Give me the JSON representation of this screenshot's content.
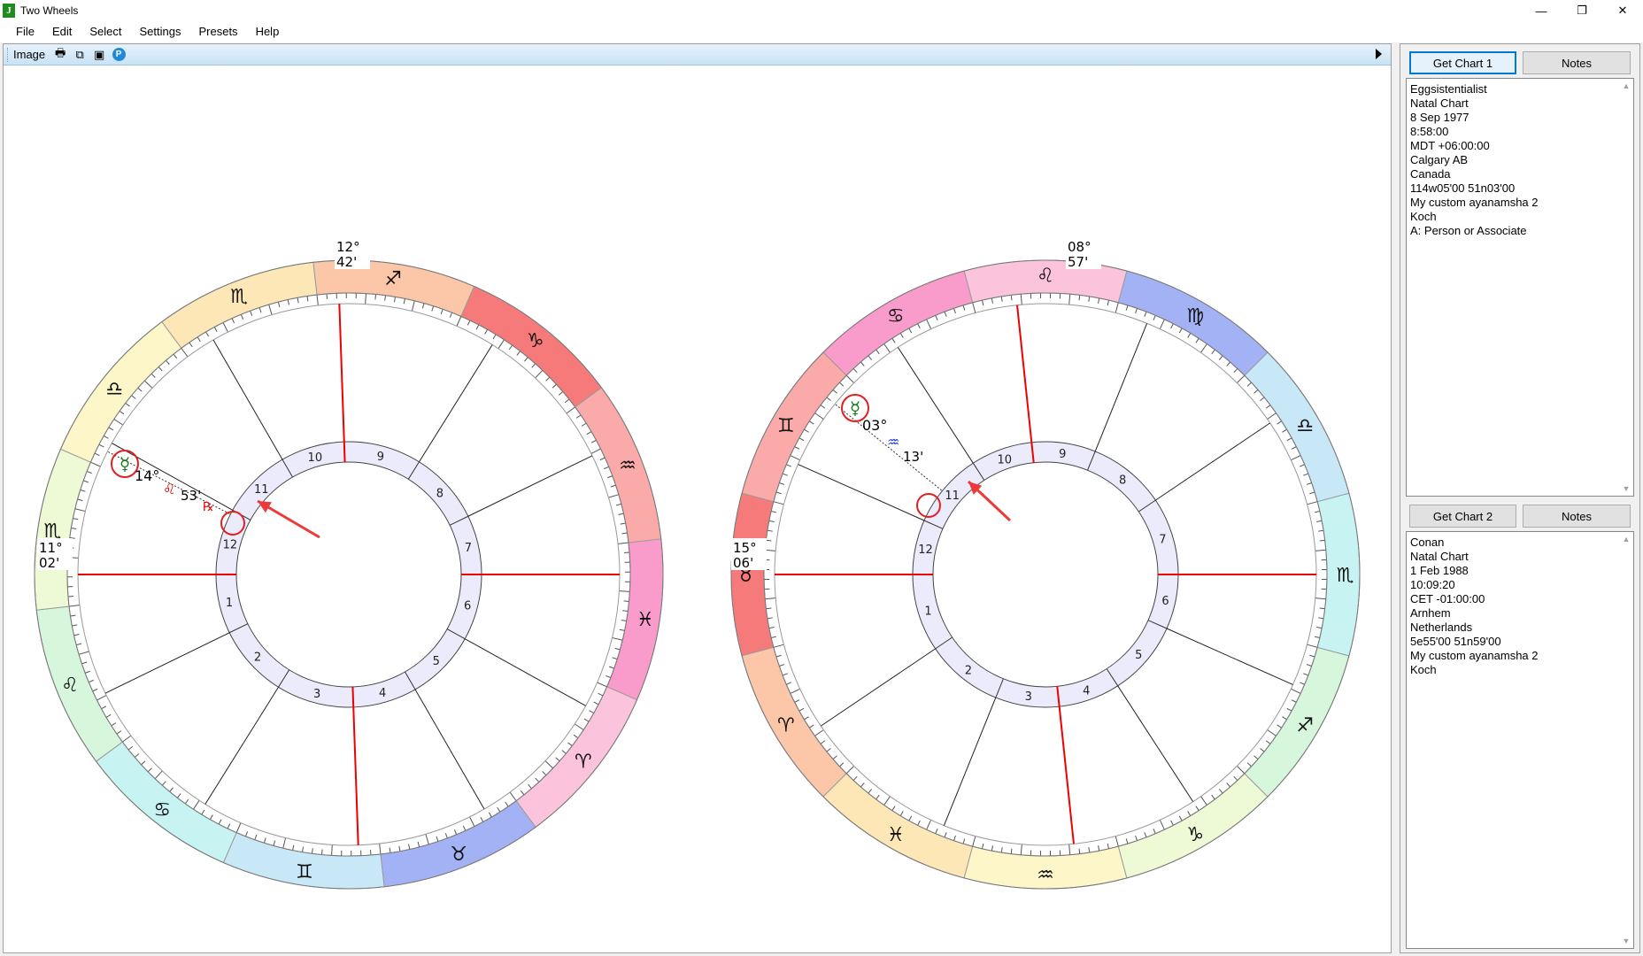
{
  "window": {
    "title": "Two Wheels",
    "app_icon_glyph": "J",
    "minimize": "—",
    "maximize": "❐",
    "close": "✕"
  },
  "menu": [
    "File",
    "Edit",
    "Select",
    "Settings",
    "Presets",
    "Help"
  ],
  "toolbar": {
    "label": "Image",
    "icons": [
      "print-icon",
      "copy-icon",
      "image-icon",
      "p-icon"
    ],
    "p_glyph": "P",
    "print_glyph": "🖶",
    "copy_glyph": "⧉",
    "image_glyph": "▣"
  },
  "wheel1": {
    "asc": {
      "deg": "11°",
      "min": "02'",
      "sign": "♏"
    },
    "mc": {
      "deg": "12°",
      "min": "42'",
      "sign": "♊"
    },
    "signs": [
      {
        "glyph": "♋",
        "color": "#fdf6c9"
      },
      {
        "glyph": "♌",
        "color": "#eef9d6"
      },
      {
        "glyph": "♏",
        "color": "#d6f7dc"
      },
      {
        "glyph": "♎",
        "color": "#c8f3f3"
      },
      {
        "glyph": "♏",
        "color": "#c8e8f8"
      },
      {
        "glyph": "♐",
        "color": "#a3b1f5"
      },
      {
        "glyph": "♑",
        "color": "#fcc3dd"
      },
      {
        "glyph": "♒",
        "color": "#f99bcb"
      },
      {
        "glyph": "♓",
        "color": "#fbaaaa"
      },
      {
        "glyph": "♈",
        "color": "#f77a7a"
      },
      {
        "glyph": "♉",
        "color": "#fbc7a8"
      },
      {
        "glyph": "♊",
        "color": "#fde7b6"
      }
    ],
    "houses": [
      "1",
      "2",
      "3",
      "4",
      "5",
      "6",
      "7",
      "8",
      "9",
      "10",
      "11",
      "12"
    ],
    "planet": {
      "glyph": "☿",
      "deg": "14°",
      "sign": "♌",
      "min": "53'",
      "retro": "℞"
    },
    "circled_house": "12"
  },
  "wheel2": {
    "asc": {
      "deg": "15°",
      "min": "06'"
    },
    "mc": {
      "deg": "08°",
      "min": "57'",
      "sign": "♐"
    },
    "signs": [
      {
        "glyph": "♈"
      },
      {
        "glyph": "♉"
      },
      {
        "glyph": "♊"
      },
      {
        "glyph": "♋"
      },
      {
        "glyph": "♌"
      },
      {
        "glyph": "♍"
      },
      {
        "glyph": "♎"
      },
      {
        "glyph": "♏"
      },
      {
        "glyph": "♐"
      },
      {
        "glyph": "♑"
      },
      {
        "glyph": "♒"
      },
      {
        "glyph": "♓"
      }
    ],
    "houses": [
      "1",
      "2",
      "3",
      "4",
      "5",
      "6",
      "7",
      "8",
      "9",
      "10",
      "11",
      "12"
    ],
    "planet": {
      "glyph": "☿",
      "deg": "03°",
      "sign": "♒",
      "min": "13'"
    },
    "circled_house": "12"
  },
  "chart1": {
    "button": "Get Chart 1",
    "notes": "Notes",
    "lines": [
      "Eggsistentialist",
      "Natal Chart",
      "8 Sep 1977",
      "8:58:00",
      "MDT +06:00:00",
      "Calgary AB",
      "Canada",
      "114w05'00 51n03'00",
      "My custom ayanamsha 2",
      "Koch",
      "A: Person or Associate"
    ]
  },
  "chart2": {
    "button": "Get Chart 2",
    "notes": "Notes",
    "lines": [
      "Conan",
      "Natal Chart",
      "1 Feb 1988",
      "10:09:20",
      "CET -01:00:00",
      "Arnhem",
      "Netherlands",
      "5e55'00 51n59'00",
      "My custom ayanamsha 2",
      "Koch"
    ]
  },
  "scroll": {
    "up": "▲",
    "down": "▼"
  }
}
